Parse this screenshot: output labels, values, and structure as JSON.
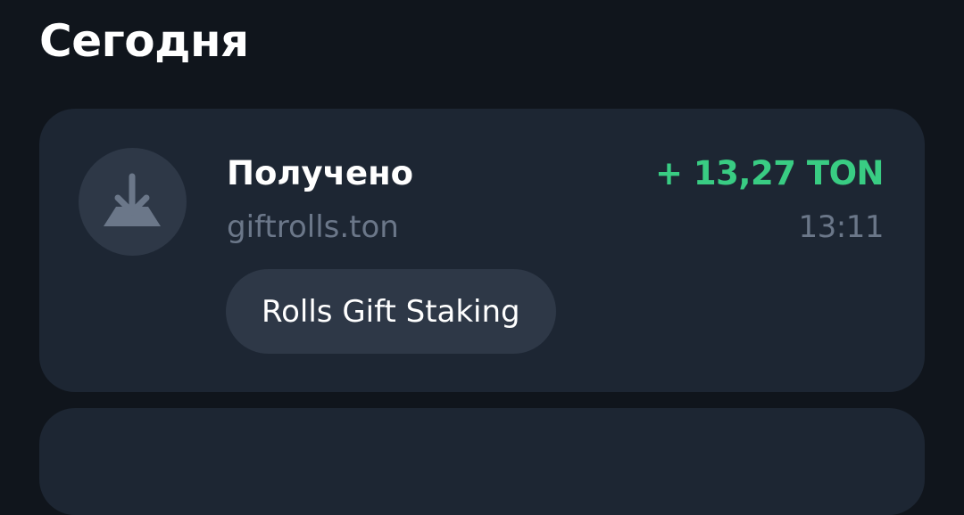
{
  "section": {
    "title": "Сегодня"
  },
  "transaction": {
    "icon": "arrow-down-receive-icon",
    "type_label": "Получено",
    "counterparty": "giftrolls.ton",
    "amount": "+ 13,27 TON",
    "time": "13:11",
    "comment": "Rolls Gift Staking"
  },
  "colors": {
    "background": "#10151c",
    "card": "#1d2633",
    "chip": "#2e3847",
    "positive_amount": "#39cc83",
    "secondary_text": "#6b7789",
    "primary_text": "#ffffff"
  }
}
